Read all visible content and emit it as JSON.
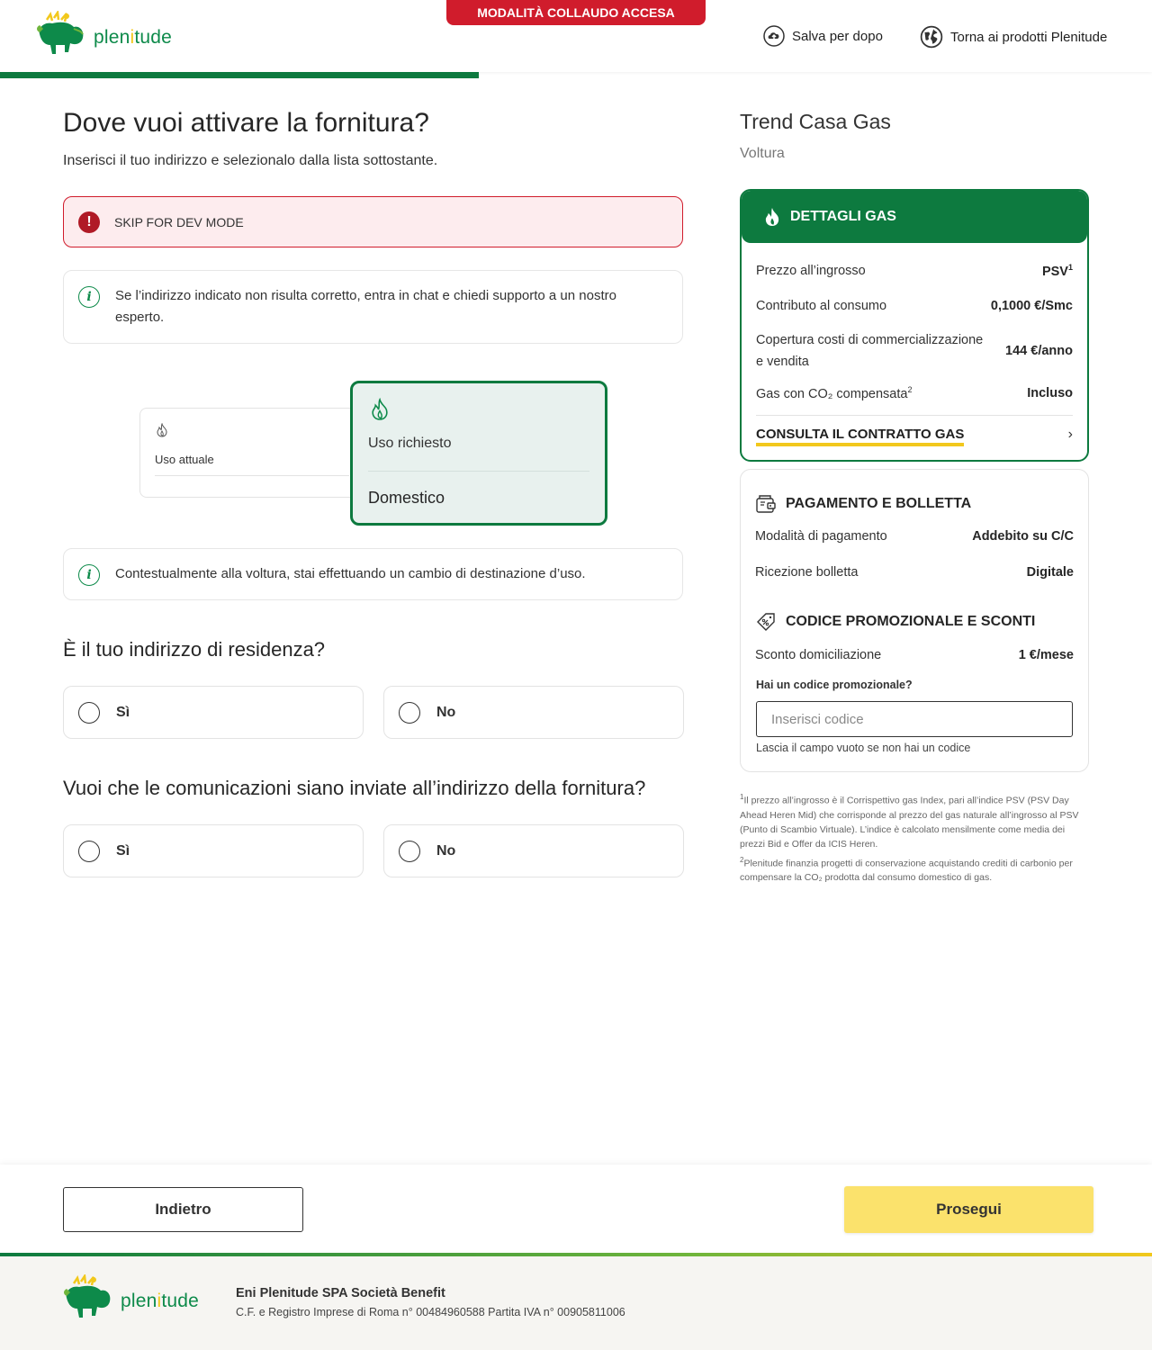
{
  "header": {
    "logo_text_a": "plen",
    "logo_text_i": "i",
    "logo_text_b": "tude",
    "banner": "MODALITÀ COLLAUDO ACCESA",
    "save_later": "Salva per dopo",
    "back_products": "Torna ai prodotti Plenitude",
    "progress_percent": 41.6
  },
  "main": {
    "title": "Dove vuoi attivare la fornitura?",
    "subtitle": "Inserisci il tuo indirizzo e selezionalo dalla lista sottostante.",
    "dev_alert": "SKIP FOR DEV MODE",
    "info_address": "Se l’indirizzo indicato non risulta corretto, entra in chat e chiedi supporto a un nostro esperto.",
    "current_use_label": "Uso attuale",
    "requested_use_label": "Uso richiesto",
    "requested_use_value": "Domestico",
    "info_change": "Contestualmente alla voltura, stai effettuando un cambio di destinazione d’uso.",
    "q_residence": "È il tuo indirizzo di residenza?",
    "q_comms": "Vuoi che le comunicazioni siano inviate all’indirizzo della fornitura?",
    "yes": "Sì",
    "no": "No"
  },
  "summary": {
    "product": "Trend Casa Gas",
    "type": "Voltura",
    "gas_title": "DETTAGLI GAS",
    "gas_rows": [
      {
        "label": "Prezzo all’ingrosso",
        "value": "PSV",
        "sup": "1"
      },
      {
        "label": "Contributo al consumo",
        "value": "0,1000 €/Smc"
      },
      {
        "label_a": "Copertura costi di commercializzazione",
        "label_b": "e vendita",
        "value": "144 €/anno"
      },
      {
        "label": "Gas con CO₂ compensata",
        "sup": "2",
        "value": "Incluso"
      }
    ],
    "contract_link": "CONSULTA IL CONTRATTO GAS",
    "pay_title": "PAGAMENTO E BOLLETTA",
    "pay_rows": [
      {
        "label": "Modalità di pagamento",
        "value": "Addebito su C/C"
      },
      {
        "label": "Ricezione bolletta",
        "value": "Digitale"
      }
    ],
    "promo_title": "CODICE PROMOZIONALE E SCONTI",
    "discount_label": "Sconto domiciliazione",
    "discount_value": "1 €/mese",
    "promo_question": "Hai un codice promozionale?",
    "promo_placeholder": "Inserisci codice",
    "promo_hint": "Lascia il campo vuoto se non hai un codice",
    "note1_sup": "1",
    "note1": "Il prezzo all’ingrosso è il Corrispettivo gas Index, pari all’indice PSV (PSV Day Ahead Heren Mid) che corrisponde al prezzo del gas naturale all’ingrosso al PSV (Punto di Scambio Virtuale). L’indice è calcolato mensilmente come media dei prezzi Bid e Offer da ICIS Heren.",
    "note2_sup": "2",
    "note2": "Plenitude finanzia progetti di conservazione acquistando crediti di carbonio per compensare la CO₂ prodotta dal consumo domestico di gas."
  },
  "actions": {
    "back": "Indietro",
    "next": "Prosegui"
  },
  "footer": {
    "company": "Eni Plenitude SPA Società Benefit",
    "registry": "C.F. e Registro Imprese di Roma n° 00484960588 Partita IVA n° 00905811006"
  },
  "colors": {
    "brand_green": "#0d7a3f",
    "brand_yellow": "#f2c81c",
    "alert_red": "#d01c2c",
    "cta_yellow": "#fbe26c"
  },
  "icons": [
    "dog-logo-icon",
    "cloud-upload-icon",
    "globe-icon",
    "exclamation-icon",
    "info-icon",
    "flame-icon",
    "chevron-right-icon",
    "wallet-icon",
    "tag-percent-icon"
  ]
}
